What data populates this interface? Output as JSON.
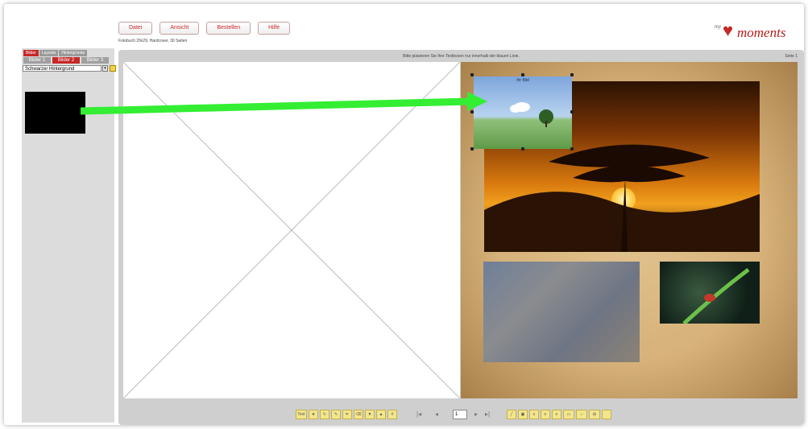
{
  "menu": {
    "items": [
      "Datei",
      "Ansicht",
      "Bestellen",
      "Hilfe"
    ]
  },
  "subtitle": "Fotobuch 29x29, Hardcover, 30 Seiten",
  "logo": {
    "prefix": "my",
    "text": "moments"
  },
  "left_panel": {
    "tabs_top": [
      "Bilder",
      "Layouts",
      "Hintergründe"
    ],
    "tabs_second": [
      "Bilder 1",
      "Bilder 2",
      "Bilder 3"
    ],
    "active_tab_second": "Bilder 2",
    "dropdown_value": "Schwarzer Hintergrund"
  },
  "editor": {
    "hint": "Bitte platzieren Sie Ihre Textboxen nur innerhalb der blauen Linie.",
    "page_label": "Seite 1",
    "sky_photo_label": "Ihr Bild"
  },
  "toolbar": {
    "first_button": "Text",
    "page_value": "1"
  },
  "colors": {
    "accent": "#c62828",
    "arrow": "#33ee33",
    "panel_bg": "#dcdcdc",
    "editor_bg": "#cfcfcf"
  }
}
